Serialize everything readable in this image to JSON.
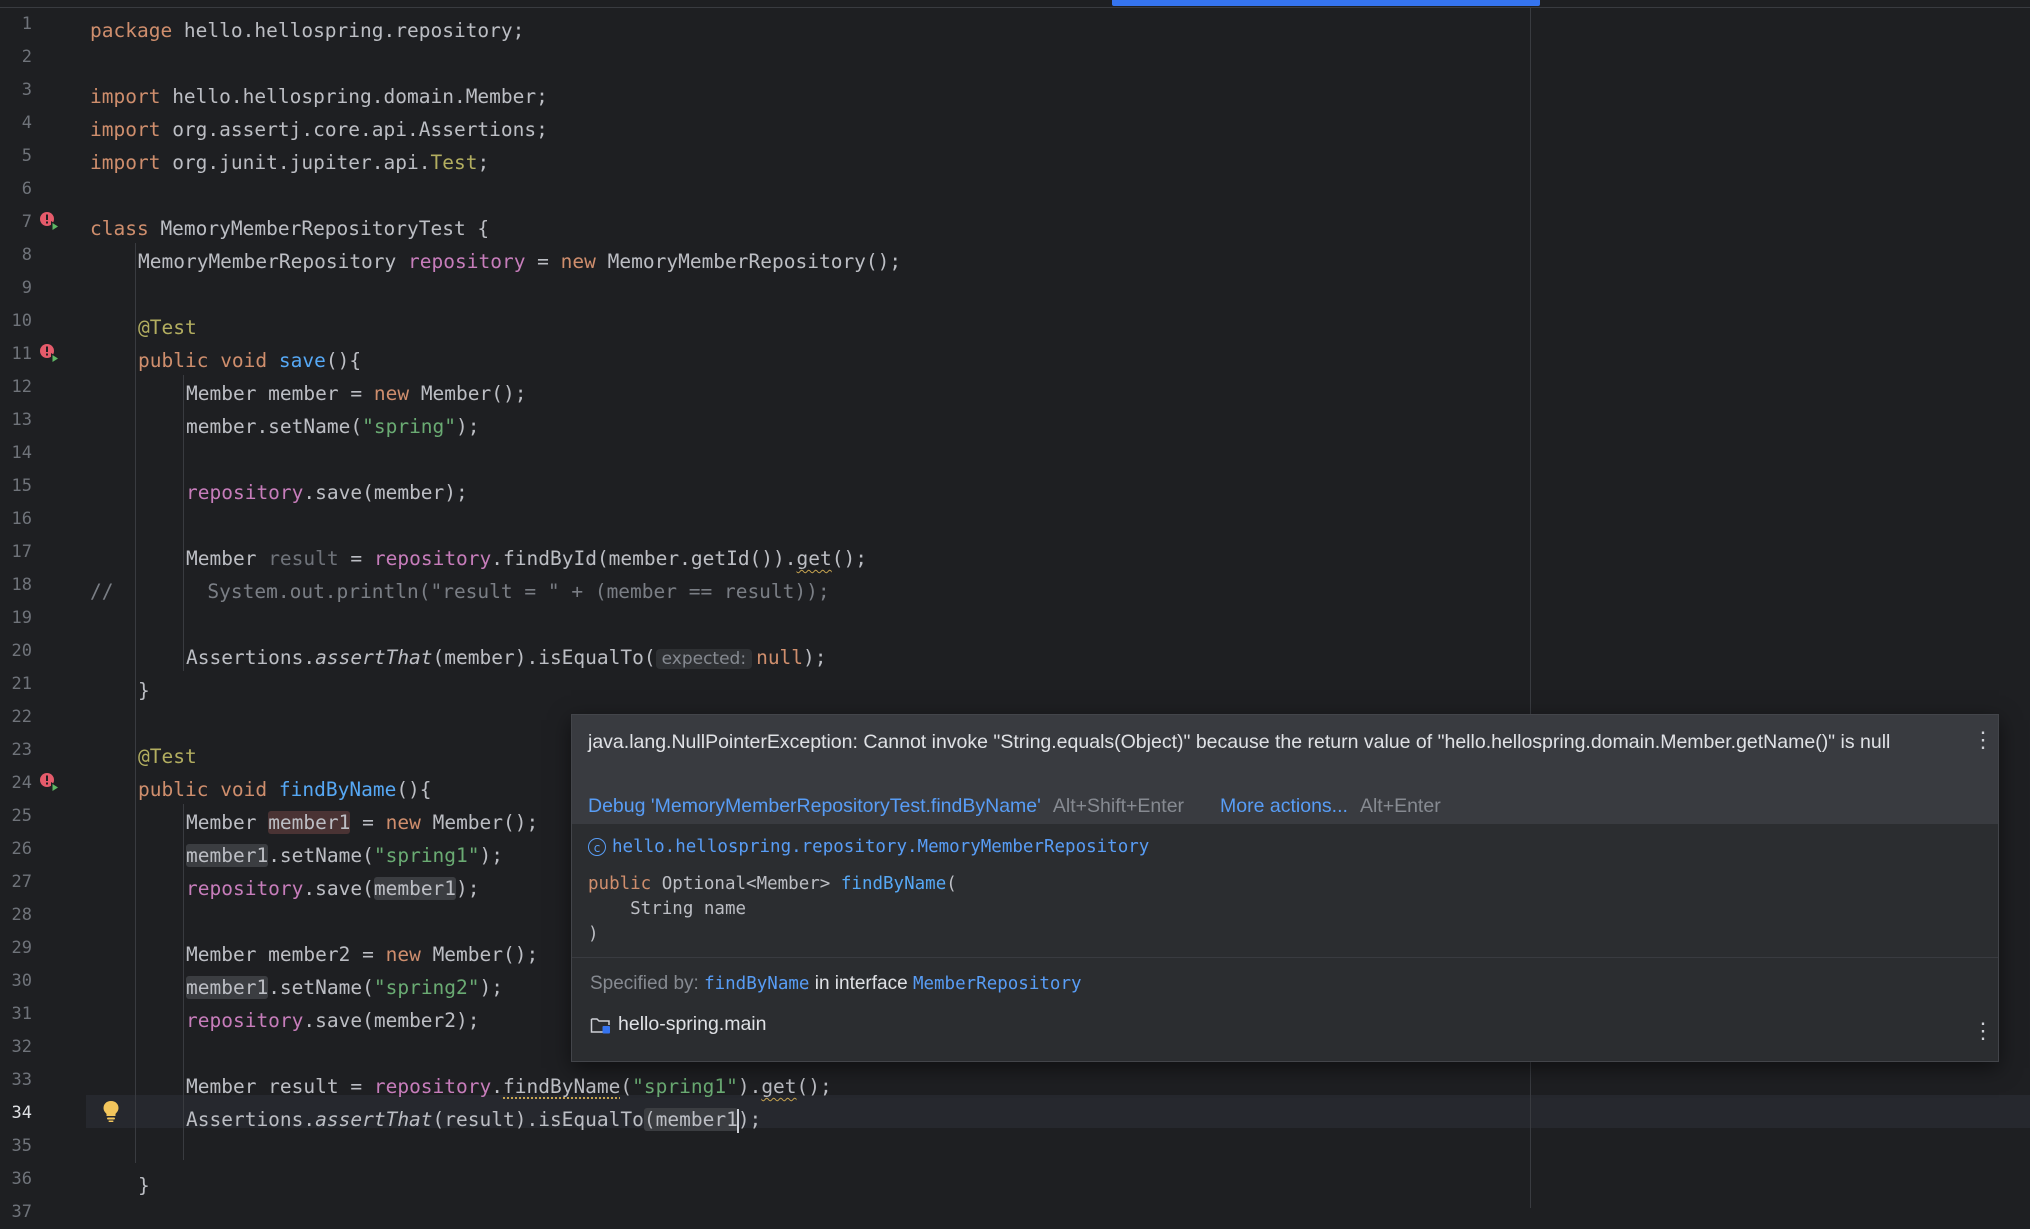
{
  "editor": {
    "current_line": 34,
    "line_numbers": [
      "1",
      "2",
      "3",
      "4",
      "5",
      "6",
      "7",
      "8",
      "9",
      "10",
      "11",
      "12",
      "13",
      "14",
      "15",
      "16",
      "17",
      "18",
      "19",
      "20",
      "21",
      "22",
      "23",
      "24",
      "25",
      "26",
      "27",
      "28",
      "29",
      "30",
      "31",
      "32",
      "33",
      "34",
      "35",
      "36",
      "37"
    ],
    "tokens": {
      "kw_package": "package",
      "pkg_name": " hello.hellospring.repository;",
      "kw_import": "import",
      "imp1": " hello.hellospring.domain.Member;",
      "imp2": " org.assertj.core.api.Assertions;",
      "imp3a": " org.junit.jupiter.api.",
      "imp3b": "Test",
      "semi": ";",
      "kw_class": "class",
      "class_name": " MemoryMemberRepositoryTest {",
      "l8a": "MemoryMemberRepository ",
      "fld_repository": "repository",
      "l8c": " = ",
      "kw_new": "new",
      "l8e": " MemoryMemberRepository();",
      "ann_test": "@Test",
      "kw_public": "public",
      "kw_void": " void ",
      "fn_save": "save",
      "paren_brace": "(){",
      "l12a": "Member member = ",
      "l12c": " Member();",
      "l13a": "member.setName(",
      "str_spring": "\"spring\"",
      "close_semi": ");",
      "l15b": ".save(member);",
      "l17a": "Member ",
      "var_result": "result",
      "l17c": " = ",
      "l17e": ".findById(member.getId()).",
      "get": "get",
      "l17g": "();",
      "l18_comment_mark": "//",
      "l18_comment_body": "        System.out.println(\"result = \" + (member == result));",
      "assertions_dot": "Assertions.",
      "assert_that": "assertThat",
      "l20c": "(member).isEqualTo(",
      "hint_expected": "expected:",
      "kw_null": "null",
      "close_brace": "}",
      "fn_findbyname": "findByName",
      "l25a": "Member ",
      "var_member1": "member1",
      "l25c": " = ",
      "l25e": " Member();",
      "l26b": ".setName(",
      "str_spring1": "\"spring1\"",
      "l27b": ".save(",
      "l29a": "Member member2 = ",
      "str_spring2": "\"spring2\"",
      "l31b": ".save(member2);",
      "l33a": "Member result = ",
      "l33c": ".",
      "l33e": "(",
      "l33g": ").",
      "l34c": "(result).isEqualTo",
      "open_paren": "(",
      "member1_partial": "member1",
      "close_paren_semi": ");"
    }
  },
  "popup": {
    "error_message": "java.lang.NullPointerException: Cannot invoke \"String.equals(Object)\" because the return value of \"hello.hellospring.domain.Member.getName()\" is null",
    "debug_action": "Debug 'MemoryMemberRepositoryTest.findByName'",
    "debug_shortcut": "Alt+Shift+Enter",
    "more_actions": "More actions...",
    "more_shortcut": "Alt+Enter",
    "class_ref": "hello.hellospring.repository.MemoryMemberRepository",
    "signature": {
      "kw_public": "public",
      "return_type": " Optional<Member> ",
      "method": "findByName",
      "open": "(",
      "param": "    String name",
      "close": ")"
    },
    "specified_by_label": "Specified by:",
    "specified_method": "findByName",
    "in_interface": "in interface",
    "interface_name": "MemberRepository",
    "module": "hello-spring.main"
  },
  "colors": {
    "background": "#1e1f22",
    "keyword": "#cf8e6d",
    "annotation": "#b3ae60",
    "field": "#c77dbb",
    "function": "#56a8f5",
    "string": "#6aab73",
    "link": "#589df6",
    "accent": "#3574f0"
  },
  "icons": {
    "run_gutter": "run-test-error-icon",
    "bulb": "lightbulb-icon",
    "class": "class-c-icon",
    "module": "module-folder-icon",
    "kebab": "more-vertical-icon"
  }
}
